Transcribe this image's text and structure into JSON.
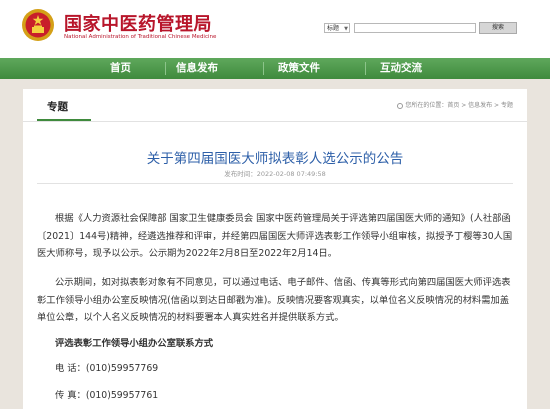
{
  "header": {
    "title": "国家中医药管理局",
    "subtitle": "National Administration of Traditional Chinese Medicine",
    "search_scope": "标题",
    "search_button": "搜索",
    "emblem_icon": "national-emblem-icon"
  },
  "nav": {
    "items": [
      {
        "label": "首页"
      },
      {
        "label": "信息发布"
      },
      {
        "label": "政策文件"
      },
      {
        "label": "互动交流"
      }
    ],
    "color": "#4c9a49"
  },
  "section": {
    "tab_label": "专题",
    "breadcrumb": "您所在的位置：首页 > 信息发布 > 专题"
  },
  "article": {
    "title": "关于第四届国医大师拟表彰人选公示的公告",
    "date": "发布时间：2022-02-08 07:49:58",
    "paragraph1": "根据《人力资源社会保障部 国家卫生健康委员会 国家中医药管理局关于评选第四届国医大师的通知》(人社部函〔2021〕144号)精神，经遴选推荐和评审，并经第四届国医大师评选表彰工作领导小组审核，拟授予丁樱等30人国医大师称号，现予以公示。公示期为2022年2月8日至2022年2月14日。",
    "paragraph2": "公示期间，如对拟表彰对象有不同意见，可以通过电话、电子邮件、信函、传真等形式向第四届国医大师评选表彰工作领导小组办公室反映情况(信函以到达日邮戳为准)。反映情况要客观真实，以单位名义反映情况的材料需加盖单位公章，以个人名义反映情况的材料要署本人真实姓名并提供联系方式。",
    "contact_heading": "评选表彰工作领导小组办公室联系方式",
    "phone": "电  话：(010)59957769",
    "fax": "传  真：(010)59957761"
  },
  "colors": {
    "brand_red": "#b8152a",
    "title_blue": "#2d5fa8",
    "nav_green": "#4c9a49"
  }
}
